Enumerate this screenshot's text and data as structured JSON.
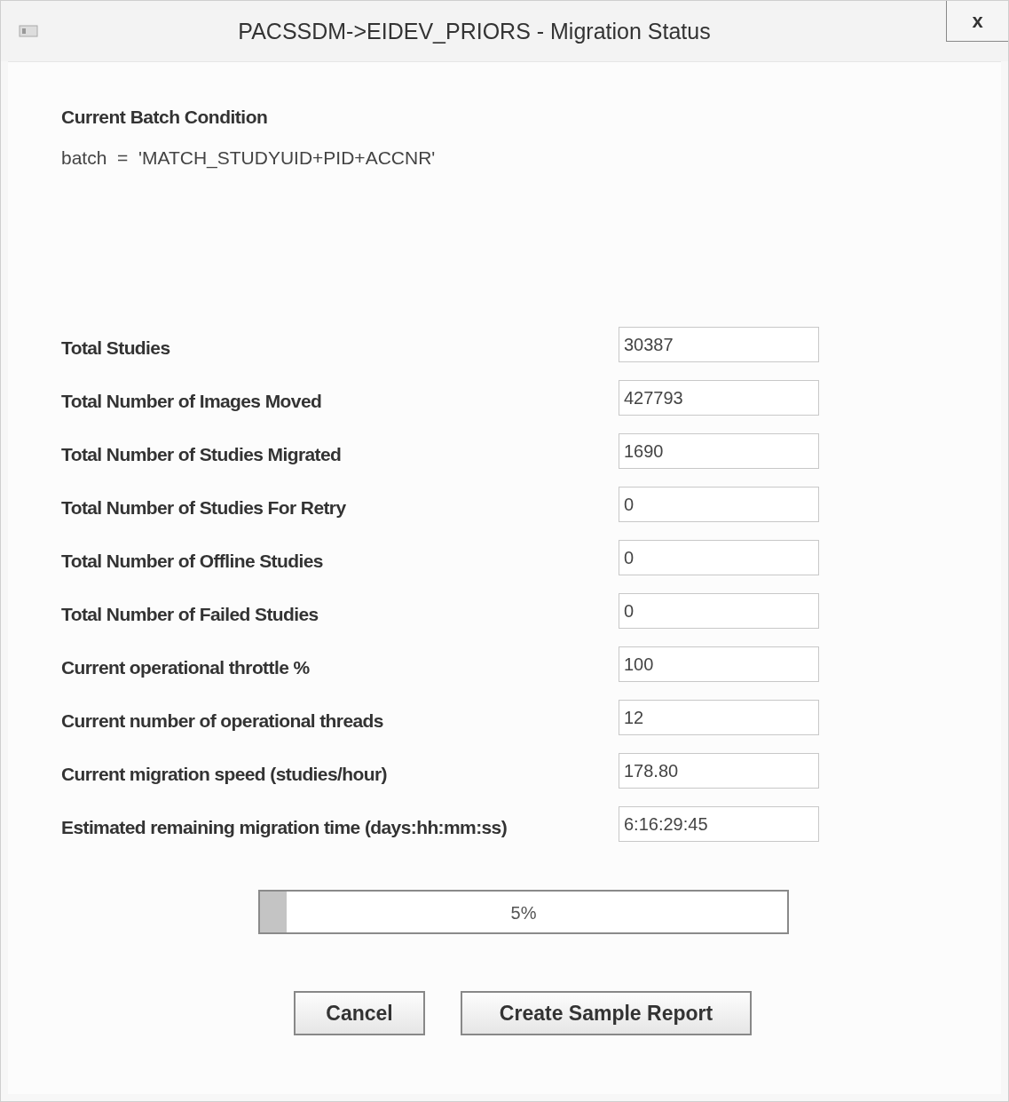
{
  "window": {
    "title": "PACSSDM->EIDEV_PRIORS - Migration Status",
    "close": "x"
  },
  "batch": {
    "heading": "Current Batch Condition",
    "condition": "batch  =  'MATCH_STUDYUID+PID+ACCNR'"
  },
  "fields": [
    {
      "label": "Total Studies",
      "value": "30387"
    },
    {
      "label": "Total Number of Images Moved",
      "value": "427793"
    },
    {
      "label": "Total Number of Studies Migrated",
      "value": "1690"
    },
    {
      "label": "Total Number of Studies For Retry",
      "value": "0"
    },
    {
      "label": "Total Number of Offline Studies",
      "value": "0"
    },
    {
      "label": "Total Number of Failed Studies",
      "value": "0"
    },
    {
      "label": "Current operational throttle %",
      "value": "100"
    },
    {
      "label": "Current number of operational threads",
      "value": "12"
    },
    {
      "label": "Current migration speed (studies/hour)",
      "value": "178.80"
    },
    {
      "label": "Estimated remaining migration time (days:hh:mm:ss)",
      "value": "6:16:29:45"
    }
  ],
  "progress": {
    "level": 0.05,
    "text": "5%"
  },
  "buttons": [
    "Cancel",
    "Create Sample Report"
  ]
}
